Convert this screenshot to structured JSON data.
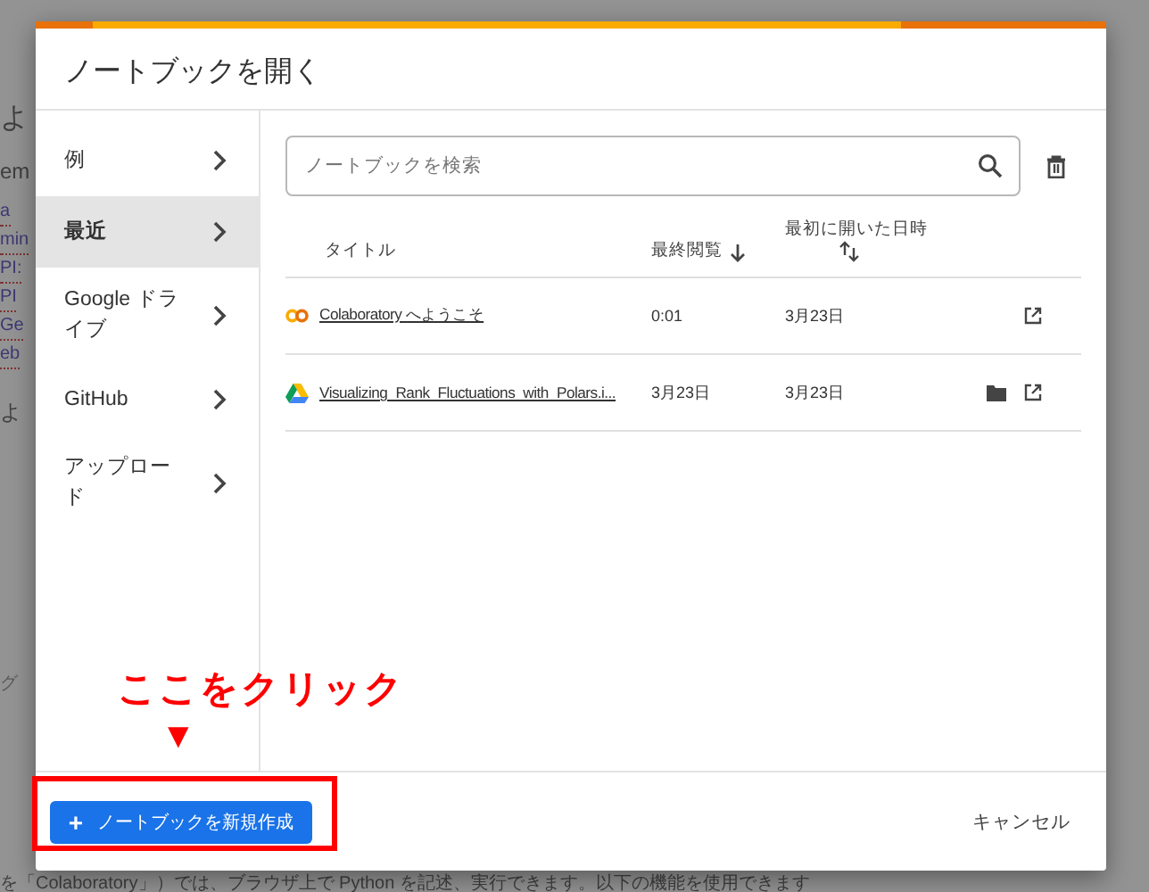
{
  "background_page": {
    "heading": "よ",
    "subheading": "em",
    "links": [
      "a",
      "min",
      "PI:",
      "PI",
      "Ge",
      "eb"
    ],
    "paragraph": "よ",
    "hint": "グ",
    "footer_text": "を「Colaboratory」）では、ブラウザ上で Python を記述、実行できます。以下の機能を使用できます"
  },
  "dialog": {
    "title": "ノートブックを開く",
    "sidebar": {
      "items": [
        {
          "label": "例",
          "selected": false
        },
        {
          "label": "最近",
          "selected": true
        },
        {
          "label": "Google ドライブ",
          "selected": false
        },
        {
          "label": "GitHub",
          "selected": false
        },
        {
          "label": "アップロード",
          "selected": false
        }
      ]
    },
    "search": {
      "placeholder": "ノートブックを検索"
    },
    "table": {
      "columns": [
        {
          "label": "タイトル",
          "kind": "plain"
        },
        {
          "label": "最終閲覧",
          "kind": "sorted"
        },
        {
          "label": "最初に開いた日時",
          "kind": "sortable"
        }
      ],
      "rows": [
        {
          "kind": "colab",
          "title": "Colaboratory へようこそ",
          "last_viewed": "0:01",
          "first_opened": "3月23日"
        },
        {
          "kind": "drive",
          "title": "Visualizing_Rank_Fluctuations_with_Polars.i...",
          "last_viewed": "3月23日",
          "first_opened": "3月23日"
        }
      ]
    },
    "new_button": {
      "icon": "+",
      "label": "ノートブックを新規作成"
    },
    "cancel_button": "キャンセル"
  },
  "annotation": {
    "text": "ここをクリック",
    "marker": "▼"
  }
}
